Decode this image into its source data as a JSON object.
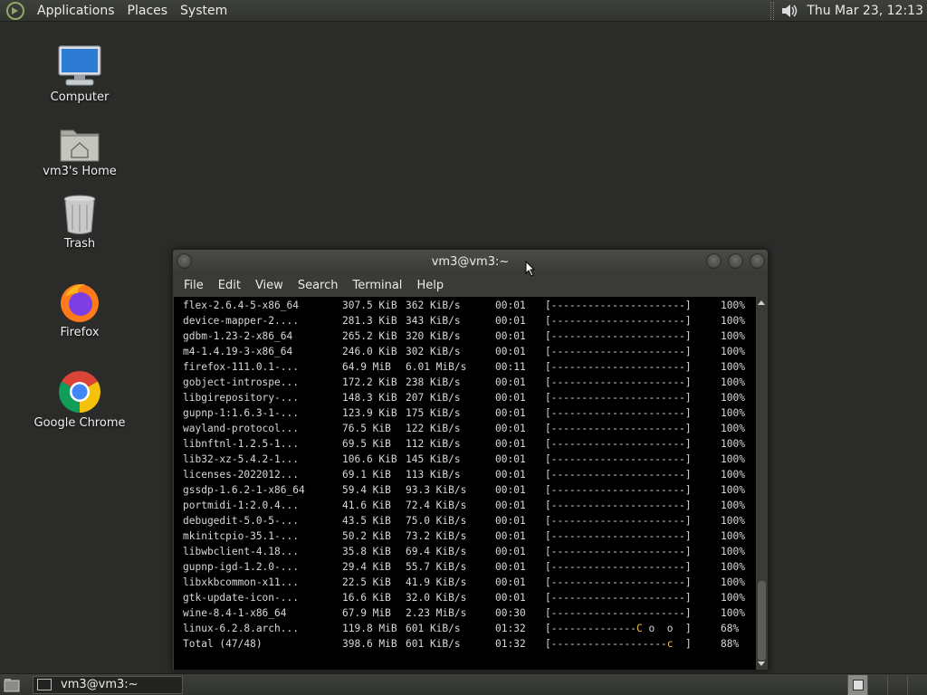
{
  "top_panel": {
    "menus": [
      "Applications",
      "Places",
      "System"
    ],
    "clock": "Thu Mar 23, 12:13"
  },
  "desktop": {
    "icons": [
      {
        "label": "Computer",
        "icon": "computer-icon"
      },
      {
        "label": "vm3's Home",
        "icon": "home-folder-icon"
      },
      {
        "label": "Trash",
        "icon": "trash-icon"
      },
      {
        "label": "Firefox",
        "icon": "firefox-icon"
      },
      {
        "label": "Google Chrome",
        "icon": "chrome-icon"
      }
    ]
  },
  "terminal": {
    "title": "vm3@vm3:~",
    "menu": [
      "File",
      "Edit",
      "View",
      "Search",
      "Terminal",
      "Help"
    ],
    "rows": [
      {
        "name": "flex-2.6.4-5-x86_64",
        "size": "307.5 KiB",
        "rate": "362 KiB/s",
        "time": "00:01",
        "bar": "[----------------------]",
        "pct": "100%"
      },
      {
        "name": "device-mapper-2....",
        "size": "281.3 KiB",
        "rate": "343 KiB/s",
        "time": "00:01",
        "bar": "[----------------------]",
        "pct": "100%"
      },
      {
        "name": "gdbm-1.23-2-x86_64",
        "size": "265.2 KiB",
        "rate": "320 KiB/s",
        "time": "00:01",
        "bar": "[----------------------]",
        "pct": "100%"
      },
      {
        "name": "m4-1.4.19-3-x86_64",
        "size": "246.0 KiB",
        "rate": "302 KiB/s",
        "time": "00:01",
        "bar": "[----------------------]",
        "pct": "100%"
      },
      {
        "name": "firefox-111.0.1-...",
        "size": "64.9 MiB",
        "rate": "6.01 MiB/s",
        "time": "00:11",
        "bar": "[----------------------]",
        "pct": "100%"
      },
      {
        "name": "gobject-introspe...",
        "size": "172.2 KiB",
        "rate": "238 KiB/s",
        "time": "00:01",
        "bar": "[----------------------]",
        "pct": "100%"
      },
      {
        "name": "libgirepository-...",
        "size": "148.3 KiB",
        "rate": "207 KiB/s",
        "time": "00:01",
        "bar": "[----------------------]",
        "pct": "100%"
      },
      {
        "name": "gupnp-1:1.6.3-1-...",
        "size": "123.9 KiB",
        "rate": "175 KiB/s",
        "time": "00:01",
        "bar": "[----------------------]",
        "pct": "100%"
      },
      {
        "name": "wayland-protocol...",
        "size": "76.5 KiB",
        "rate": "122 KiB/s",
        "time": "00:01",
        "bar": "[----------------------]",
        "pct": "100%"
      },
      {
        "name": "libnftnl-1.2.5-1...",
        "size": "69.5 KiB",
        "rate": "112 KiB/s",
        "time": "00:01",
        "bar": "[----------------------]",
        "pct": "100%"
      },
      {
        "name": "lib32-xz-5.4.2-1...",
        "size": "106.6 KiB",
        "rate": "145 KiB/s",
        "time": "00:01",
        "bar": "[----------------------]",
        "pct": "100%"
      },
      {
        "name": "licenses-2022012...",
        "size": "69.1 KiB",
        "rate": "113 KiB/s",
        "time": "00:01",
        "bar": "[----------------------]",
        "pct": "100%"
      },
      {
        "name": "gssdp-1.6.2-1-x86_64",
        "size": "59.4 KiB",
        "rate": "93.3 KiB/s",
        "time": "00:01",
        "bar": "[----------------------]",
        "pct": "100%"
      },
      {
        "name": "portmidi-1:2.0.4...",
        "size": "41.6 KiB",
        "rate": "72.4 KiB/s",
        "time": "00:01",
        "bar": "[----------------------]",
        "pct": "100%"
      },
      {
        "name": "debugedit-5.0-5-...",
        "size": "43.5 KiB",
        "rate": "75.0 KiB/s",
        "time": "00:01",
        "bar": "[----------------------]",
        "pct": "100%"
      },
      {
        "name": "mkinitcpio-35.1-...",
        "size": "50.2 KiB",
        "rate": "73.2 KiB/s",
        "time": "00:01",
        "bar": "[----------------------]",
        "pct": "100%"
      },
      {
        "name": "libwbclient-4.18...",
        "size": "35.8 KiB",
        "rate": "69.4 KiB/s",
        "time": "00:01",
        "bar": "[----------------------]",
        "pct": "100%"
      },
      {
        "name": "gupnp-igd-1.2.0-...",
        "size": "29.4 KiB",
        "rate": "55.7 KiB/s",
        "time": "00:01",
        "bar": "[----------------------]",
        "pct": "100%"
      },
      {
        "name": "libxkbcommon-x11...",
        "size": "22.5 KiB",
        "rate": "41.9 KiB/s",
        "time": "00:01",
        "bar": "[----------------------]",
        "pct": "100%"
      },
      {
        "name": "gtk-update-icon-...",
        "size": "16.6 KiB",
        "rate": "32.0 KiB/s",
        "time": "00:01",
        "bar": "[----------------------]",
        "pct": "100%"
      },
      {
        "name": "wine-8.4-1-x86_64",
        "size": "67.9 MiB",
        "rate": "2.23 MiB/s",
        "time": "00:30",
        "bar": "[----------------------]",
        "pct": "100%"
      },
      {
        "name": "linux-6.2.8.arch...",
        "size": "119.8 MiB",
        "rate": "601 KiB/s",
        "time": "01:32",
        "bar_done": "[--------------",
        "bar_pac": "C",
        "bar_rest": " o  o  ]",
        "pct": "68%"
      },
      {
        "name": "Total (47/48)",
        "size": "398.6 MiB",
        "rate": "601 KiB/s",
        "time": "01:32",
        "bar_done": "[-------------------",
        "bar_pac": "c",
        "bar_rest": "  ]",
        "pct": "88%"
      }
    ]
  },
  "taskbar": {
    "task_label": "vm3@vm3:~"
  }
}
